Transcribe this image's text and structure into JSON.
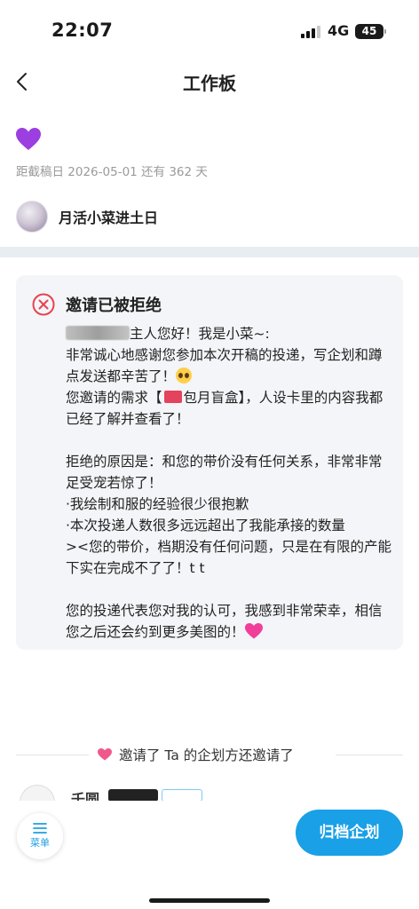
{
  "status_bar": {
    "time": "22:07",
    "network": "4G",
    "battery": "45"
  },
  "nav": {
    "title": "工作板"
  },
  "deadline_text": "距截稿日 2026-05-01 还有 362 天",
  "author": {
    "name": "月活小菜进土日"
  },
  "rejection_card": {
    "title": "邀请已被拒绝",
    "greeting_suffix": "主人您好！我是小菜~:",
    "line_thanks": "非常诚心地感谢您参加本次开稿的投递，写企划和蹲点发送都辛苦了！",
    "line_demand_prefix": "您邀请的需求【",
    "line_demand_item": "包月盲盒",
    "line_demand_suffix": "】，人设卡里的内容我都已经了解并查看了！",
    "line_reason": "拒绝的原因是：和您的带价没有任何关系，非常非常足受宠若惊了！",
    "line_point1": "·我绘制和服的经验很少很抱歉",
    "line_point2": "·本次投递人数很多远远超出了我能承接的数量",
    "line_point3": "><您的带价，档期没有任何问题，只是在有限的产能下实在完成不了了！t t",
    "line_closing": "您的投递代表您对我的认可，我感到非常荣幸，相信您之后还会约到更多美图的！"
  },
  "invite_section": {
    "text": "邀请了 Ta 的企划方还邀请了"
  },
  "peek_item": {
    "name": "千圆"
  },
  "bottom_bar": {
    "menu_label": "菜单",
    "archive_label": "归档企划"
  },
  "colors": {
    "accent": "#1aa0e6",
    "reject_red": "#e8424f",
    "divider": "#e8edf2",
    "card_bg": "#f3f5f8",
    "emoji_purple_heart": "#9b3fe0",
    "emoji_pink_heart": "#f03e9a"
  },
  "icons": {
    "back": "chevron-left-icon",
    "reject": "x-circle-icon",
    "menu": "menu-lines-icon"
  }
}
